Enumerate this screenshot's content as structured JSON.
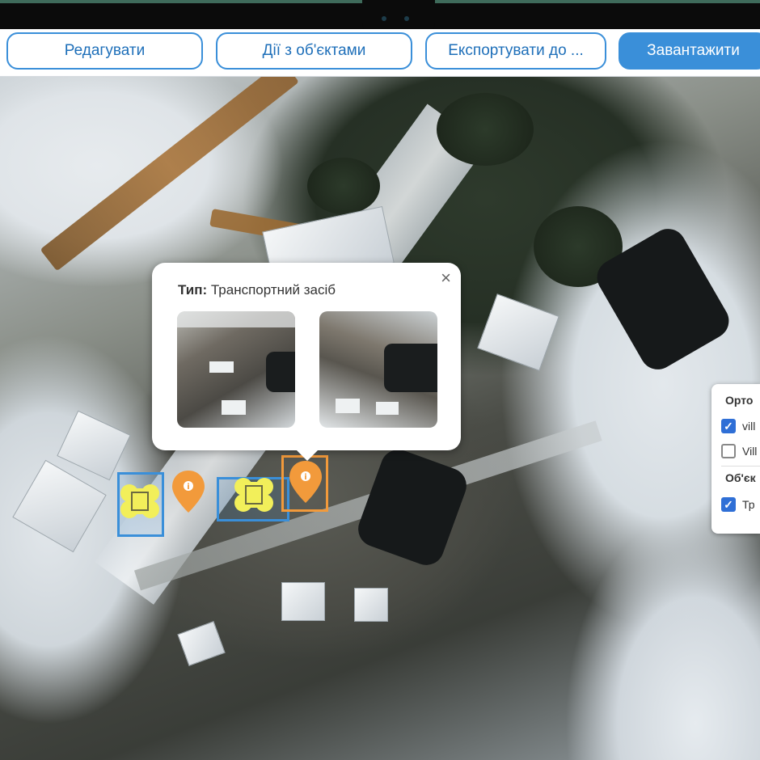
{
  "toolbar": {
    "edit_label": "Редагувати",
    "objects_label": "Дії з об'єктами",
    "export_label": "Експортувати до ...",
    "download_label": "Завантажити"
  },
  "popup": {
    "type_label": "Тип:",
    "type_value": "Транспортний засіб",
    "close_glyph": "×"
  },
  "layers_panel": {
    "orthophoto_header": "Орто",
    "orthophoto_items": [
      {
        "label": "vill",
        "checked": true
      },
      {
        "label": "Vill",
        "checked": false
      }
    ],
    "objects_header": "Об'єк",
    "object_items": [
      {
        "label": "Тр",
        "checked": true
      }
    ]
  },
  "markers": {
    "vehicle_icon": "vehicle-icon",
    "info_pin_icon": "info-pin-icon",
    "info_glyph": "i"
  },
  "colors": {
    "accent_blue": "#3a8fd9",
    "pin_orange": "#f29a3b",
    "vehicle_yellow": "#f2ef5a",
    "checkbox_blue": "#2f6fd6"
  }
}
